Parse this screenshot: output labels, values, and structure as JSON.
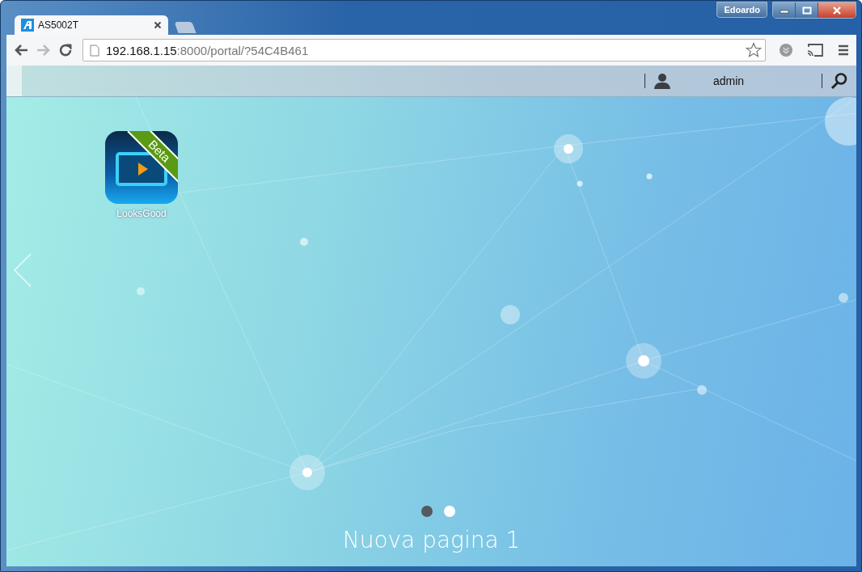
{
  "window": {
    "user": "Edoardo"
  },
  "tabs": [
    {
      "title": "AS5002T",
      "selected": true
    },
    {
      "selected": false
    }
  ],
  "address_bar": {
    "host": "192.168.1.15",
    "rest": ":8000/portal/?54C4B461"
  },
  "nav": {
    "back_disabled": false,
    "forward_disabled": true
  },
  "top_bar": {
    "user": "admin"
  },
  "apps": [
    {
      "label": "LooksGood",
      "badge": "Beta"
    }
  ],
  "pages": [
    {
      "selected": true
    },
    {
      "selected": false
    }
  ],
  "page_title": "Nuova pagina 1"
}
